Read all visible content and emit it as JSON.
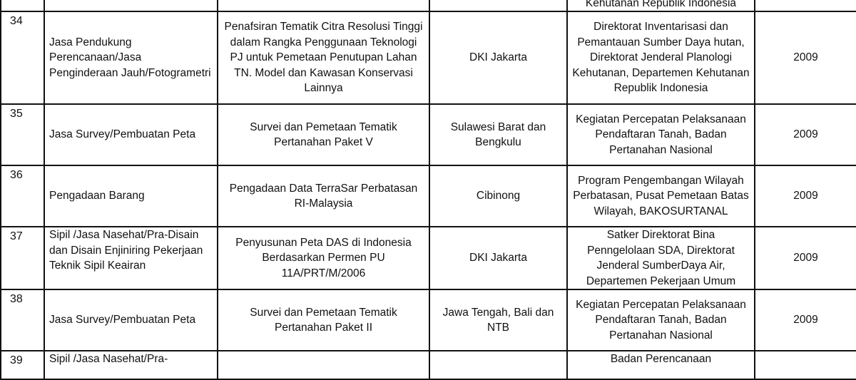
{
  "top_partial_row": {
    "agency": "Kehutanan Republik Indonesia"
  },
  "rows": [
    {
      "no": "34",
      "category": "Jasa Pendukung Perencanaan/Jasa Penginderaan Jauh/Fotogrametri",
      "project": "Penafsiran Tematik Citra Resolusi Tinggi dalam Rangka Penggunaan Teknologi PJ untuk Pemetaan Penutupan Lahan TN. Model dan Kawasan Konservasi Lainnya",
      "location": "DKI Jakarta",
      "agency": "Direktorat Inventarisasi dan Pemantauan Sumber Daya hutan, Direktorat Jenderal Planologi Kehutanan, Departemen Kehutanan Republik Indonesia",
      "year": "2009"
    },
    {
      "no": "35",
      "category": "Jasa Survey/Pembuatan Peta",
      "project": "Survei dan Pemetaan Tematik Pertanahan Paket V",
      "location": "Sulawesi Barat dan Bengkulu",
      "agency": "Kegiatan Percepatan Pelaksanaan Pendaftaran Tanah, Badan Pertanahan Nasional",
      "year": "2009"
    },
    {
      "no": "36",
      "category": "Pengadaan Barang",
      "project": "Pengadaan Data TerraSar Perbatasan RI-Malaysia",
      "location": "Cibinong",
      "agency": "Program Pengembangan Wilayah Perbatasan, Pusat Pemetaan Batas Wilayah, BAKOSURTANAL",
      "year": "2009"
    },
    {
      "no": "37",
      "category": "Sipil /Jasa Nasehat/Pra-Disain dan Disain Enjiniring Pekerjaan Teknik Sipil Keairan",
      "project": "Penyusunan Peta DAS di Indonesia Berdasarkan Permen PU 11A/PRT/M/2006",
      "location": "DKI Jakarta",
      "agency": "Satker Direktorat Bina Penngelolaan SDA, Direktorat Jenderal SumberDaya Air, Departemen Pekerjaan Umum",
      "year": "2009"
    },
    {
      "no": "38",
      "category": "Jasa Survey/Pembuatan Peta",
      "project": "Survei dan Pemetaan Tematik Pertanahan Paket II",
      "location": "Jawa Tengah, Bali dan NTB",
      "agency": "Kegiatan Percepatan Pelaksanaan Pendaftaran Tanah, Badan Pertanahan Nasional",
      "year": "2009"
    }
  ],
  "bottom_partial_row": {
    "no": "39",
    "category": "Sipil /Jasa Nasehat/Pra-",
    "agency": "Badan Perencanaan"
  }
}
